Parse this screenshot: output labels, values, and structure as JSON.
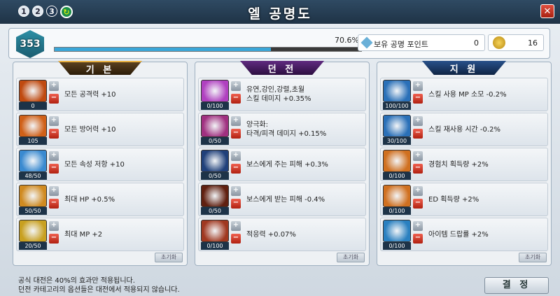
{
  "window": {
    "title": "엘 공명도",
    "close_label": "✕",
    "tabs": [
      "1",
      "2",
      "3"
    ]
  },
  "top": {
    "level": "353",
    "progress_text": "70.6%",
    "progress": 0.706,
    "point_label": "보유 공명 포인트",
    "point_value": "0",
    "coin_value": "16"
  },
  "panels": [
    {
      "title": "기 본",
      "reset": "초기화",
      "items": [
        {
          "count": "0",
          "desc": "모든 공격력 +10",
          "color": "#c04a10"
        },
        {
          "count": "105",
          "desc": "모든 방어력 +10",
          "color": "#d06018"
        },
        {
          "count": "48/50",
          "desc": "모든 속성 저항 +10",
          "color": "#3a8ad0"
        },
        {
          "count": "50/50",
          "desc": "최대 HP +0.5%",
          "color": "#d08a20"
        },
        {
          "count": "20/50",
          "desc": "최대 MP +2",
          "color": "#c8a020"
        }
      ]
    },
    {
      "title": "던 전",
      "reset": "초기화",
      "items": [
        {
          "count": "0/100",
          "desc": "유연,강인,강렬,초월\n스킬 데미지 +0.35%",
          "color": "#b040c0"
        },
        {
          "count": "0/50",
          "desc": "양극화:\n타격/피격 데미지 +0.15%",
          "color": "#a03080"
        },
        {
          "count": "0/50",
          "desc": "보스에게 주는 피해 +0.3%",
          "color": "#20407a"
        },
        {
          "count": "0/50",
          "desc": "보스에게 받는 피해 -0.4%",
          "color": "#602010"
        },
        {
          "count": "0/100",
          "desc": "적응력 +0.07%",
          "color": "#a03820"
        }
      ]
    },
    {
      "title": "지 원",
      "reset": "초기화",
      "items": [
        {
          "count": "100/100",
          "desc": "스킬 사용 MP 소모 -0.2%",
          "color": "#2a70b8"
        },
        {
          "count": "30/100",
          "desc": "스킬 재사용 시간 -0.2%",
          "color": "#2a70b8"
        },
        {
          "count": "0/100",
          "desc": "경험치 획득량 +2%",
          "color": "#d07020"
        },
        {
          "count": "0/100",
          "desc": "ED 획득량 +2%",
          "color": "#d07020"
        },
        {
          "count": "0/100",
          "desc": "아이템 드랍률 +2%",
          "color": "#2a80c0"
        }
      ]
    }
  ],
  "footer": {
    "note1": "공식 대전은 40%의 효과만 적용됩니다.",
    "note2": "던전 카테고리의 옵션들은 대전에서 적용되지 않습니다.",
    "confirm": "결 정"
  }
}
